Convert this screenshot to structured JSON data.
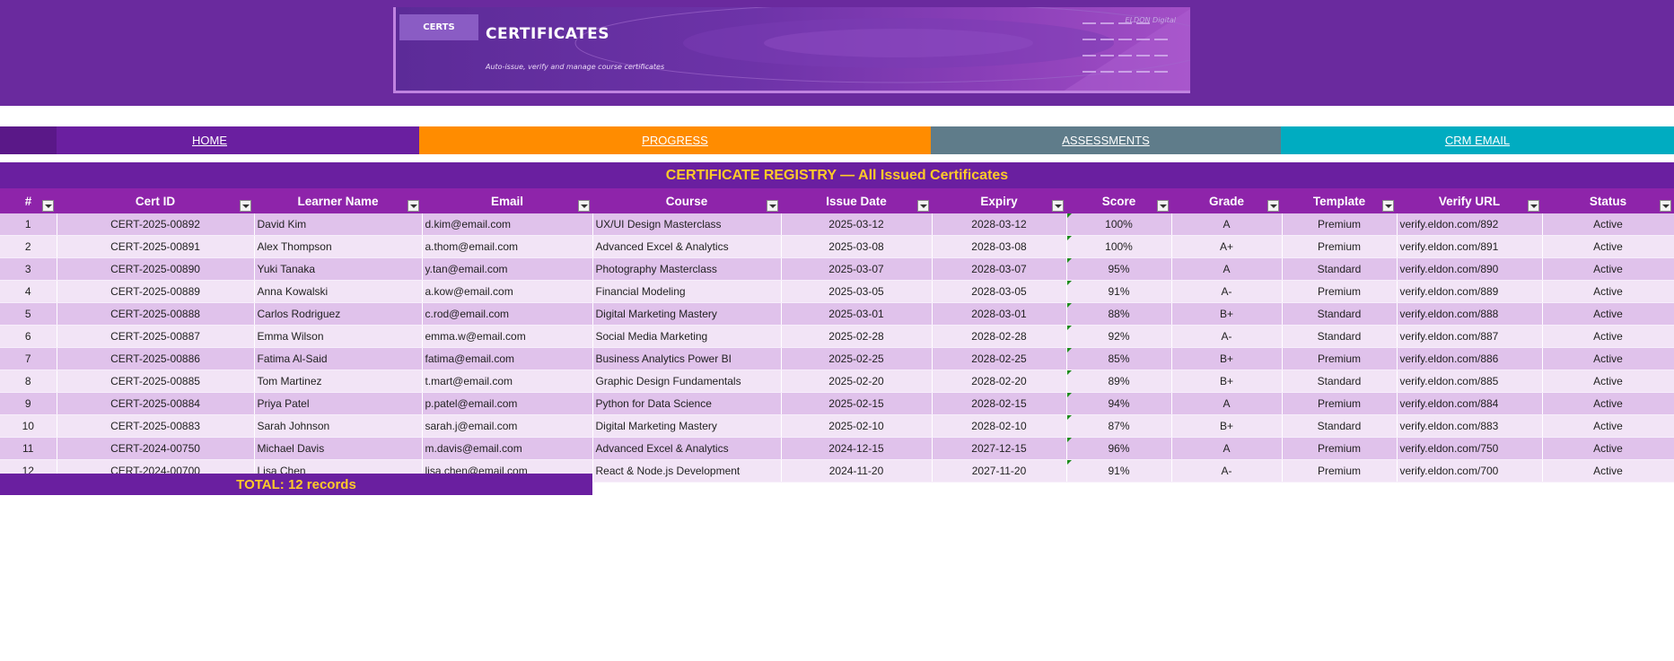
{
  "banner": {
    "badge": "CERTS",
    "title": "CERTIFICATES",
    "subtitle": "Auto-issue, verify and manage course certificates",
    "brand": "ELDON Digital"
  },
  "nav": {
    "home": "HOME",
    "progress": "PROGRESS",
    "assessments": "ASSESSMENTS",
    "crm_email": "CRM EMAIL"
  },
  "colors": {
    "header_purple": "#6a2a9e",
    "table_header": "#8e24aa",
    "accent_yellow": "#ffca28",
    "progress_orange": "#ff8c00",
    "assessments_gray": "#5f7c8a",
    "crm_cyan": "#00acc1"
  },
  "registry": {
    "title": "CERTIFICATE REGISTRY — All Issued Certificates",
    "headers": [
      "#",
      "Cert ID",
      "Learner Name",
      "Email",
      "Course",
      "Issue Date",
      "Expiry",
      "Score",
      "Grade",
      "Template",
      "Verify URL",
      "Status"
    ],
    "rows": [
      [
        "1",
        "CERT-2025-00892",
        "David Kim",
        "d.kim@email.com",
        "UX/UI Design Masterclass",
        "2025-03-12",
        "2028-03-12",
        "100%",
        "A",
        "Premium",
        "verify.eldon.com/892",
        "Active"
      ],
      [
        "2",
        "CERT-2025-00891",
        "Alex Thompson",
        "a.thom@email.com",
        "Advanced Excel & Analytics",
        "2025-03-08",
        "2028-03-08",
        "100%",
        "A+",
        "Premium",
        "verify.eldon.com/891",
        "Active"
      ],
      [
        "3",
        "CERT-2025-00890",
        "Yuki Tanaka",
        "y.tan@email.com",
        "Photography Masterclass",
        "2025-03-07",
        "2028-03-07",
        "95%",
        "A",
        "Standard",
        "verify.eldon.com/890",
        "Active"
      ],
      [
        "4",
        "CERT-2025-00889",
        "Anna Kowalski",
        "a.kow@email.com",
        "Financial Modeling",
        "2025-03-05",
        "2028-03-05",
        "91%",
        "A-",
        "Premium",
        "verify.eldon.com/889",
        "Active"
      ],
      [
        "5",
        "CERT-2025-00888",
        "Carlos Rodriguez",
        "c.rod@email.com",
        "Digital Marketing Mastery",
        "2025-03-01",
        "2028-03-01",
        "88%",
        "B+",
        "Standard",
        "verify.eldon.com/888",
        "Active"
      ],
      [
        "6",
        "CERT-2025-00887",
        "Emma Wilson",
        "emma.w@email.com",
        "Social Media Marketing",
        "2025-02-28",
        "2028-02-28",
        "92%",
        "A-",
        "Standard",
        "verify.eldon.com/887",
        "Active"
      ],
      [
        "7",
        "CERT-2025-00886",
        "Fatima Al-Said",
        "fatima@email.com",
        "Business Analytics Power BI",
        "2025-02-25",
        "2028-02-25",
        "85%",
        "B+",
        "Premium",
        "verify.eldon.com/886",
        "Active"
      ],
      [
        "8",
        "CERT-2025-00885",
        "Tom Martinez",
        "t.mart@email.com",
        "Graphic Design Fundamentals",
        "2025-02-20",
        "2028-02-20",
        "89%",
        "B+",
        "Standard",
        "verify.eldon.com/885",
        "Active"
      ],
      [
        "9",
        "CERT-2025-00884",
        "Priya Patel",
        "p.patel@email.com",
        "Python for Data Science",
        "2025-02-15",
        "2028-02-15",
        "94%",
        "A",
        "Premium",
        "verify.eldon.com/884",
        "Active"
      ],
      [
        "10",
        "CERT-2025-00883",
        "Sarah Johnson",
        "sarah.j@email.com",
        "Digital Marketing Mastery",
        "2025-02-10",
        "2028-02-10",
        "87%",
        "B+",
        "Standard",
        "verify.eldon.com/883",
        "Active"
      ],
      [
        "11",
        "CERT-2024-00750",
        "Michael Davis",
        "m.davis@email.com",
        "Advanced Excel & Analytics",
        "2024-12-15",
        "2027-12-15",
        "96%",
        "A",
        "Premium",
        "verify.eldon.com/750",
        "Active"
      ],
      [
        "12",
        "CERT-2024-00700",
        "Lisa Chen",
        "lisa.chen@email.com",
        "React & Node.js Development",
        "2024-11-20",
        "2027-11-20",
        "91%",
        "A-",
        "Premium",
        "verify.eldon.com/700",
        "Active"
      ]
    ],
    "total": "TOTAL: 12 records"
  }
}
